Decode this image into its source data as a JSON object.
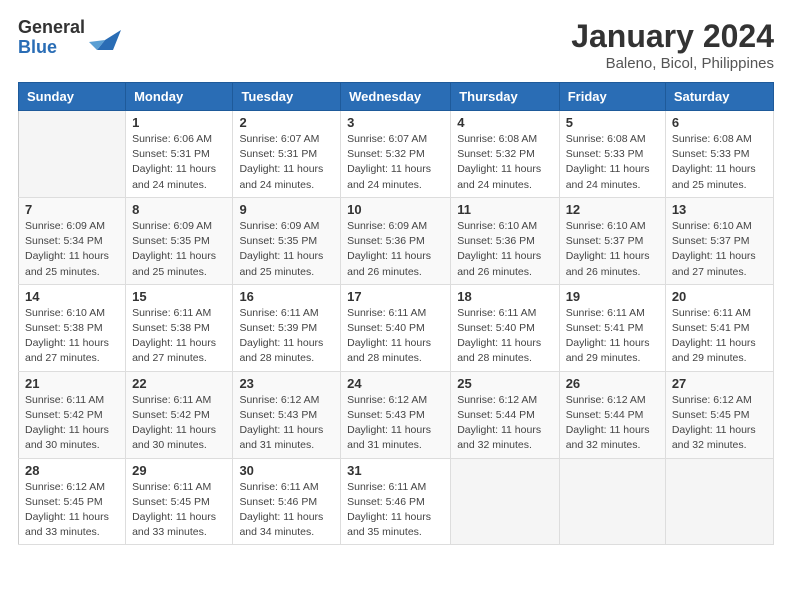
{
  "logo": {
    "general": "General",
    "blue": "Blue"
  },
  "title": "January 2024",
  "subtitle": "Baleno, Bicol, Philippines",
  "days_of_week": [
    "Sunday",
    "Monday",
    "Tuesday",
    "Wednesday",
    "Thursday",
    "Friday",
    "Saturday"
  ],
  "weeks": [
    [
      {
        "day": "",
        "sunrise": "",
        "sunset": "",
        "daylight": ""
      },
      {
        "day": "1",
        "sunrise": "Sunrise: 6:06 AM",
        "sunset": "Sunset: 5:31 PM",
        "daylight": "Daylight: 11 hours and 24 minutes."
      },
      {
        "day": "2",
        "sunrise": "Sunrise: 6:07 AM",
        "sunset": "Sunset: 5:31 PM",
        "daylight": "Daylight: 11 hours and 24 minutes."
      },
      {
        "day": "3",
        "sunrise": "Sunrise: 6:07 AM",
        "sunset": "Sunset: 5:32 PM",
        "daylight": "Daylight: 11 hours and 24 minutes."
      },
      {
        "day": "4",
        "sunrise": "Sunrise: 6:08 AM",
        "sunset": "Sunset: 5:32 PM",
        "daylight": "Daylight: 11 hours and 24 minutes."
      },
      {
        "day": "5",
        "sunrise": "Sunrise: 6:08 AM",
        "sunset": "Sunset: 5:33 PM",
        "daylight": "Daylight: 11 hours and 24 minutes."
      },
      {
        "day": "6",
        "sunrise": "Sunrise: 6:08 AM",
        "sunset": "Sunset: 5:33 PM",
        "daylight": "Daylight: 11 hours and 25 minutes."
      }
    ],
    [
      {
        "day": "7",
        "sunrise": "Sunrise: 6:09 AM",
        "sunset": "Sunset: 5:34 PM",
        "daylight": "Daylight: 11 hours and 25 minutes."
      },
      {
        "day": "8",
        "sunrise": "Sunrise: 6:09 AM",
        "sunset": "Sunset: 5:35 PM",
        "daylight": "Daylight: 11 hours and 25 minutes."
      },
      {
        "day": "9",
        "sunrise": "Sunrise: 6:09 AM",
        "sunset": "Sunset: 5:35 PM",
        "daylight": "Daylight: 11 hours and 25 minutes."
      },
      {
        "day": "10",
        "sunrise": "Sunrise: 6:09 AM",
        "sunset": "Sunset: 5:36 PM",
        "daylight": "Daylight: 11 hours and 26 minutes."
      },
      {
        "day": "11",
        "sunrise": "Sunrise: 6:10 AM",
        "sunset": "Sunset: 5:36 PM",
        "daylight": "Daylight: 11 hours and 26 minutes."
      },
      {
        "day": "12",
        "sunrise": "Sunrise: 6:10 AM",
        "sunset": "Sunset: 5:37 PM",
        "daylight": "Daylight: 11 hours and 26 minutes."
      },
      {
        "day": "13",
        "sunrise": "Sunrise: 6:10 AM",
        "sunset": "Sunset: 5:37 PM",
        "daylight": "Daylight: 11 hours and 27 minutes."
      }
    ],
    [
      {
        "day": "14",
        "sunrise": "Sunrise: 6:10 AM",
        "sunset": "Sunset: 5:38 PM",
        "daylight": "Daylight: 11 hours and 27 minutes."
      },
      {
        "day": "15",
        "sunrise": "Sunrise: 6:11 AM",
        "sunset": "Sunset: 5:38 PM",
        "daylight": "Daylight: 11 hours and 27 minutes."
      },
      {
        "day": "16",
        "sunrise": "Sunrise: 6:11 AM",
        "sunset": "Sunset: 5:39 PM",
        "daylight": "Daylight: 11 hours and 28 minutes."
      },
      {
        "day": "17",
        "sunrise": "Sunrise: 6:11 AM",
        "sunset": "Sunset: 5:40 PM",
        "daylight": "Daylight: 11 hours and 28 minutes."
      },
      {
        "day": "18",
        "sunrise": "Sunrise: 6:11 AM",
        "sunset": "Sunset: 5:40 PM",
        "daylight": "Daylight: 11 hours and 28 minutes."
      },
      {
        "day": "19",
        "sunrise": "Sunrise: 6:11 AM",
        "sunset": "Sunset: 5:41 PM",
        "daylight": "Daylight: 11 hours and 29 minutes."
      },
      {
        "day": "20",
        "sunrise": "Sunrise: 6:11 AM",
        "sunset": "Sunset: 5:41 PM",
        "daylight": "Daylight: 11 hours and 29 minutes."
      }
    ],
    [
      {
        "day": "21",
        "sunrise": "Sunrise: 6:11 AM",
        "sunset": "Sunset: 5:42 PM",
        "daylight": "Daylight: 11 hours and 30 minutes."
      },
      {
        "day": "22",
        "sunrise": "Sunrise: 6:11 AM",
        "sunset": "Sunset: 5:42 PM",
        "daylight": "Daylight: 11 hours and 30 minutes."
      },
      {
        "day": "23",
        "sunrise": "Sunrise: 6:12 AM",
        "sunset": "Sunset: 5:43 PM",
        "daylight": "Daylight: 11 hours and 31 minutes."
      },
      {
        "day": "24",
        "sunrise": "Sunrise: 6:12 AM",
        "sunset": "Sunset: 5:43 PM",
        "daylight": "Daylight: 11 hours and 31 minutes."
      },
      {
        "day": "25",
        "sunrise": "Sunrise: 6:12 AM",
        "sunset": "Sunset: 5:44 PM",
        "daylight": "Daylight: 11 hours and 32 minutes."
      },
      {
        "day": "26",
        "sunrise": "Sunrise: 6:12 AM",
        "sunset": "Sunset: 5:44 PM",
        "daylight": "Daylight: 11 hours and 32 minutes."
      },
      {
        "day": "27",
        "sunrise": "Sunrise: 6:12 AM",
        "sunset": "Sunset: 5:45 PM",
        "daylight": "Daylight: 11 hours and 32 minutes."
      }
    ],
    [
      {
        "day": "28",
        "sunrise": "Sunrise: 6:12 AM",
        "sunset": "Sunset: 5:45 PM",
        "daylight": "Daylight: 11 hours and 33 minutes."
      },
      {
        "day": "29",
        "sunrise": "Sunrise: 6:11 AM",
        "sunset": "Sunset: 5:45 PM",
        "daylight": "Daylight: 11 hours and 33 minutes."
      },
      {
        "day": "30",
        "sunrise": "Sunrise: 6:11 AM",
        "sunset": "Sunset: 5:46 PM",
        "daylight": "Daylight: 11 hours and 34 minutes."
      },
      {
        "day": "31",
        "sunrise": "Sunrise: 6:11 AM",
        "sunset": "Sunset: 5:46 PM",
        "daylight": "Daylight: 11 hours and 35 minutes."
      },
      {
        "day": "",
        "sunrise": "",
        "sunset": "",
        "daylight": ""
      },
      {
        "day": "",
        "sunrise": "",
        "sunset": "",
        "daylight": ""
      },
      {
        "day": "",
        "sunrise": "",
        "sunset": "",
        "daylight": ""
      }
    ]
  ]
}
